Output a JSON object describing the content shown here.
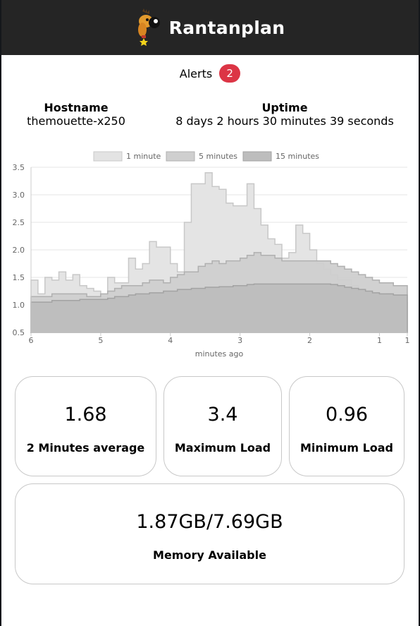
{
  "header": {
    "title": "Rantanplan",
    "logo": "rantanplan-dog-logo"
  },
  "alerts": {
    "label": "Alerts",
    "count": "2"
  },
  "host_info": {
    "hostname_label": "Hostname",
    "hostname": "themouette-x250",
    "uptime_label": "Uptime",
    "uptime": "8 days 2 hours 30 minutes 39 seconds"
  },
  "colors": {
    "header_bg": "#252525",
    "badge": "#dc3545"
  },
  "chart_data": {
    "type": "area",
    "xlabel": "minutes ago",
    "ylabel": "",
    "x_ticks": [
      "6",
      "5",
      "4",
      "3",
      "2",
      "1",
      "1"
    ],
    "y_ticks": [
      "0.5",
      "1.0",
      "1.5",
      "2.0",
      "2.5",
      "3.0",
      "3.5"
    ],
    "xlim": [
      6,
      0.6
    ],
    "ylim": [
      0.5,
      3.5
    ],
    "grid": true,
    "legend_position": "top",
    "x": [
      6.0,
      5.9,
      5.8,
      5.7,
      5.6,
      5.5,
      5.4,
      5.3,
      5.2,
      5.1,
      5.0,
      4.9,
      4.8,
      4.7,
      4.6,
      4.5,
      4.4,
      4.3,
      4.2,
      4.1,
      4.0,
      3.9,
      3.8,
      3.7,
      3.6,
      3.5,
      3.4,
      3.3,
      3.2,
      3.1,
      3.0,
      2.9,
      2.8,
      2.7,
      2.6,
      2.5,
      2.4,
      2.3,
      2.2,
      2.1,
      2.0,
      1.9,
      1.8,
      1.7,
      1.6,
      1.5,
      1.4,
      1.3,
      1.2,
      1.1,
      1.0,
      0.9,
      0.8,
      0.7,
      0.6
    ],
    "series": [
      {
        "name": "1 minute",
        "values": [
          1.45,
          1.2,
          1.5,
          1.45,
          1.6,
          1.45,
          1.55,
          1.35,
          1.3,
          1.25,
          1.1,
          1.5,
          1.4,
          1.4,
          1.85,
          1.65,
          1.75,
          2.15,
          2.05,
          2.05,
          1.75,
          1.6,
          2.5,
          3.2,
          3.2,
          3.4,
          3.15,
          3.1,
          2.85,
          2.8,
          2.8,
          3.2,
          2.75,
          2.45,
          2.2,
          2.1,
          1.85,
          1.95,
          2.45,
          2.3,
          2.0,
          1.75,
          1.65,
          1.55,
          1.45,
          1.45,
          1.35,
          1.2,
          1.05,
          0.98,
          0.96,
          1.2,
          1.1,
          1.05,
          1.05
        ]
      },
      {
        "name": "5 minutes",
        "values": [
          1.15,
          1.15,
          1.15,
          1.2,
          1.2,
          1.2,
          1.2,
          1.2,
          1.15,
          1.15,
          1.2,
          1.25,
          1.3,
          1.35,
          1.35,
          1.35,
          1.4,
          1.45,
          1.45,
          1.4,
          1.5,
          1.55,
          1.6,
          1.6,
          1.7,
          1.75,
          1.8,
          1.75,
          1.8,
          1.8,
          1.85,
          1.9,
          1.95,
          1.9,
          1.9,
          1.85,
          1.8,
          1.8,
          1.8,
          1.8,
          1.8,
          1.8,
          1.8,
          1.75,
          1.7,
          1.65,
          1.6,
          1.55,
          1.5,
          1.45,
          1.4,
          1.4,
          1.35,
          1.35,
          1.35
        ]
      },
      {
        "name": "15 minutes",
        "values": [
          1.05,
          1.05,
          1.05,
          1.08,
          1.08,
          1.08,
          1.08,
          1.1,
          1.1,
          1.1,
          1.1,
          1.12,
          1.15,
          1.15,
          1.18,
          1.2,
          1.2,
          1.22,
          1.22,
          1.25,
          1.25,
          1.28,
          1.28,
          1.3,
          1.3,
          1.32,
          1.32,
          1.33,
          1.33,
          1.35,
          1.35,
          1.37,
          1.38,
          1.38,
          1.38,
          1.38,
          1.38,
          1.38,
          1.38,
          1.38,
          1.38,
          1.38,
          1.38,
          1.37,
          1.35,
          1.32,
          1.3,
          1.28,
          1.25,
          1.22,
          1.2,
          1.2,
          1.18,
          1.18,
          1.18
        ]
      }
    ]
  },
  "stats": [
    {
      "value": "1.68",
      "label": "2 Minutes average"
    },
    {
      "value": "3.4",
      "label": "Maximum Load"
    },
    {
      "value": "0.96",
      "label": "Minimum Load"
    }
  ],
  "memory": {
    "value": "1.87GB/7.69GB",
    "label": "Memory Available"
  }
}
